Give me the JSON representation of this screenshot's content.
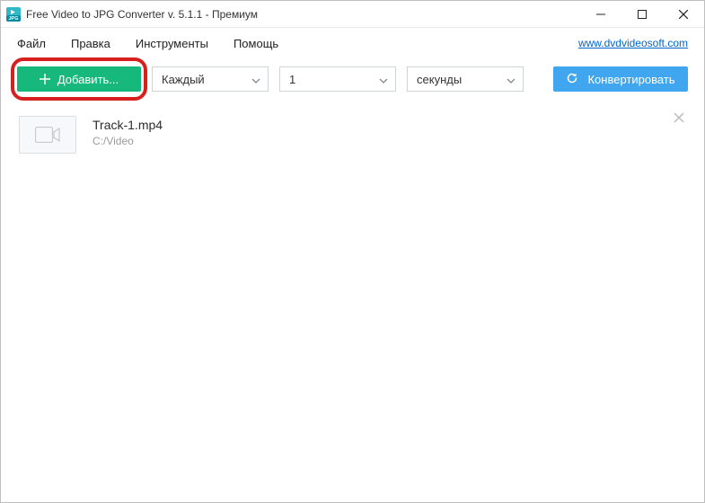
{
  "titlebar": {
    "title": "Free Video to JPG Converter v. 5.1.1 - Премиум"
  },
  "menubar": {
    "items": [
      "Файл",
      "Правка",
      "Инструменты",
      "Помощь"
    ],
    "link_text": "www.dvdvideosoft.com"
  },
  "toolbar": {
    "add_label": "Добавить...",
    "convert_label": "Конвертировать",
    "mode_select": {
      "value": "Каждый"
    },
    "value_select": {
      "value": "1"
    },
    "unit_select": {
      "value": "секунды"
    }
  },
  "files": [
    {
      "name": "Track-1.mp4",
      "path": "C:/Video"
    }
  ],
  "colors": {
    "accent_green": "#17b87b",
    "accent_blue": "#3fa6ef",
    "highlight_red": "#d6201e"
  }
}
